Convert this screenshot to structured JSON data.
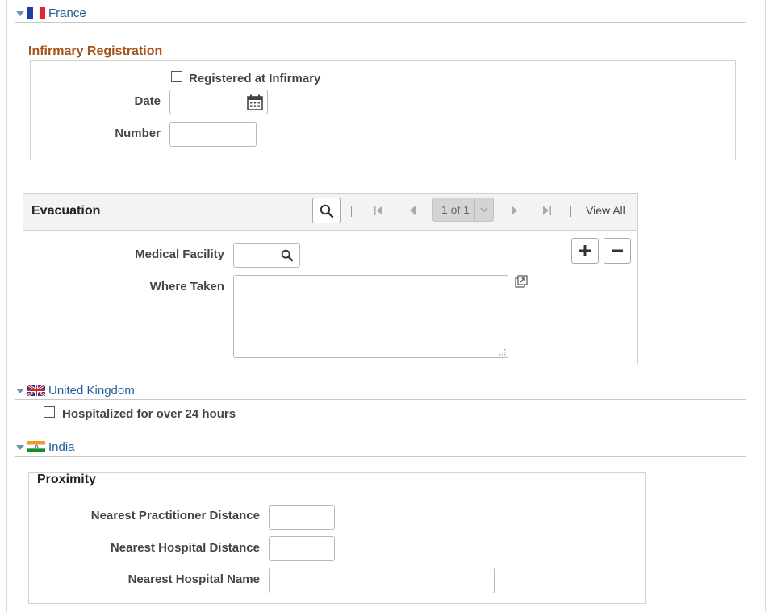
{
  "sections": {
    "france": {
      "label": "France"
    },
    "uk": {
      "label": "United Kingdom"
    },
    "india": {
      "label": "India"
    }
  },
  "infirmary": {
    "title": "Infirmary Registration",
    "registered_label": "Registered at Infirmary",
    "date_label": "Date",
    "date_value": "",
    "number_label": "Number",
    "number_value": ""
  },
  "evacuation": {
    "title": "Evacuation",
    "pagination": "1 of 1",
    "view_all": "View All",
    "medical_facility_label": "Medical Facility",
    "medical_facility_value": "",
    "where_taken_label": "Where Taken",
    "where_taken_value": ""
  },
  "uk": {
    "hospitalized_label": "Hospitalized for over 24 hours"
  },
  "proximity": {
    "title": "Proximity",
    "practitioner_distance_label": "Nearest Practitioner Distance",
    "hospital_distance_label": "Nearest Hospital Distance",
    "hospital_name_label": "Nearest Hospital Name"
  },
  "icons": {
    "collapse": "triangle-down-icon",
    "calendar": "calendar-icon",
    "search": "search-icon",
    "first": "first-page-icon",
    "prev": "previous-page-icon",
    "next": "next-page-icon",
    "last": "last-page-icon",
    "add": "plus-icon",
    "remove": "minus-icon",
    "popup": "expand-popup-icon"
  },
  "colors": {
    "section_link": "#1f5d99",
    "infirmary_title": "#a5541a"
  }
}
